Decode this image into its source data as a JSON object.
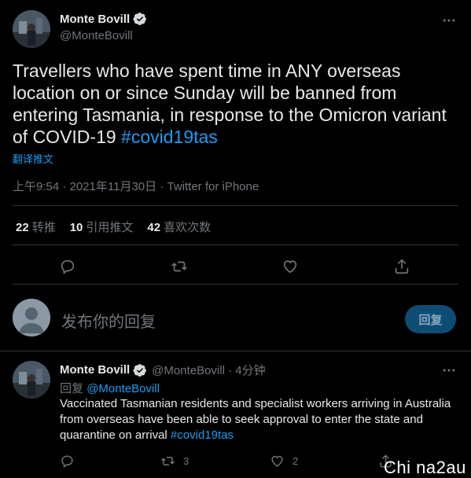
{
  "main_tweet": {
    "display_name": "Monte Bovill",
    "handle": "@MonteBovill",
    "text_before_hashtag": "Travellers who have spent time in ANY overseas location on or since Sunday will be banned from entering Tasmania, in response to the Omicron variant of COVID-19 ",
    "hashtag": "#covid19tas",
    "translate_label": "翻译推文",
    "meta": "上午9:54 · 2021年11月30日 · Twitter for iPhone",
    "stats": [
      {
        "num": "22",
        "label": "转推"
      },
      {
        "num": "10",
        "label": "引用推文"
      },
      {
        "num": "42",
        "label": "喜欢次数"
      }
    ],
    "icons": {
      "more": "more-icon",
      "reply": "reply-icon",
      "retweet": "retweet-icon",
      "like": "like-icon",
      "share": "share-icon",
      "verified": "verified-badge-icon"
    }
  },
  "compose": {
    "placeholder": "发布你的回复",
    "reply_button": "回复"
  },
  "reply_tweet": {
    "display_name": "Monte Bovill",
    "handle_time": "@MonteBovill · 4分钟",
    "reply_to_label": "回复",
    "reply_to_mention": "@MonteBovill",
    "text_before_hashtag": "Vaccinated Tasmanian residents and specialist workers arriving in Australia from overseas have been able to seek approval to enter the state and quarantine on arrival ",
    "hashtag": "#covid19tas",
    "retweet_count": "3",
    "like_count": "2"
  },
  "watermark": "Chi na2au",
  "colors": {
    "background": "#000000",
    "text": "#e7e9ea",
    "secondary": "#71767b",
    "accent": "#1d9bf0",
    "divider": "#2f3336"
  }
}
